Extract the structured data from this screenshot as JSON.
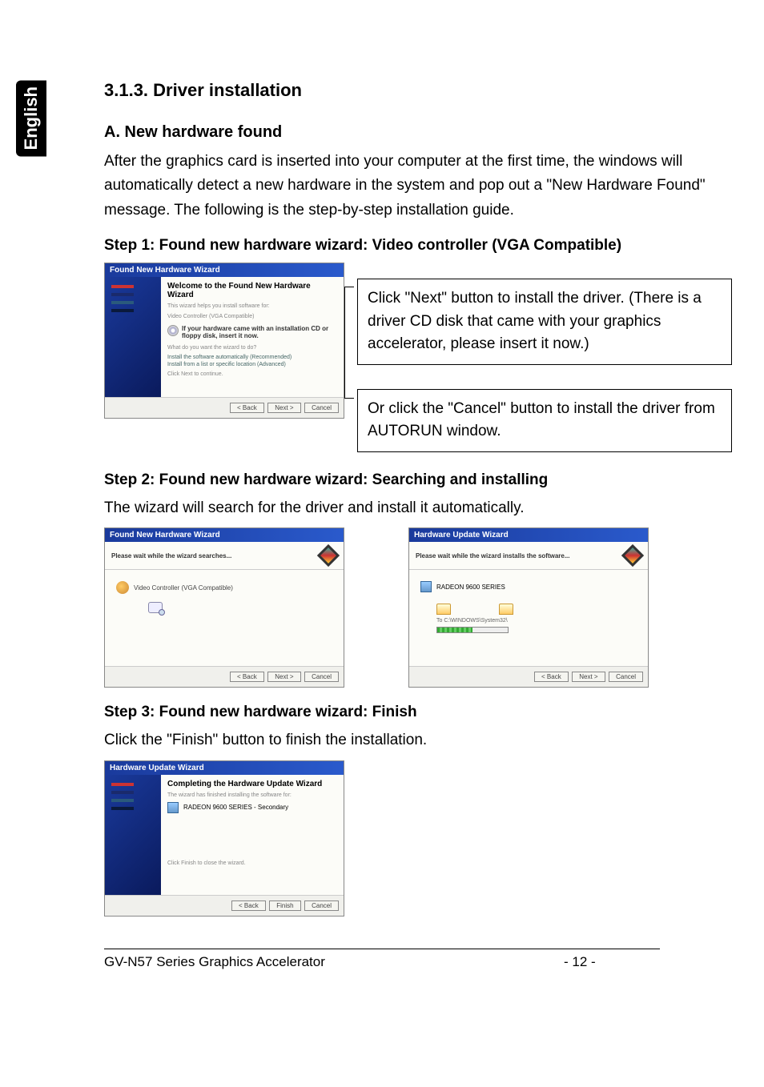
{
  "sideTab": "English",
  "section": {
    "number": "3.1.3. Driver installation",
    "subA": "A. New hardware found",
    "introText": "After the graphics card is inserted into your computer at the first time, the windows will automatically detect a new hardware in the system and pop out a \"New Hardware Found\" message. The following is the step-by-step installation guide."
  },
  "step1": {
    "title": "Step 1: Found new hardware wizard: Video controller (VGA Compatible)",
    "wizardTitle": "Found New Hardware Wizard",
    "welcome": "Welcome to the Found New Hardware Wizard",
    "wizText1": "This wizard helps you install software for:",
    "wizText2": "Video Controller (VGA Compatible)",
    "cdText": "If your hardware came with an installation CD or floppy disk, insert it now.",
    "question": "What do you want the wizard to do?",
    "radio1": "Install the software automatically (Recommended)",
    "radio2": "Install from a list or specific location (Advanced)",
    "continue": "Click Next to continue.",
    "btnBack": "< Back",
    "btnNext": "Next >",
    "btnCancel": "Cancel",
    "callout1": "Click \"Next\" button to install the driver. (There is a driver CD disk that came with your graphics accelerator, please insert it now.)",
    "callout2": "Or click the \"Cancel\" button to install the driver from AUTORUN window."
  },
  "step2": {
    "title": "Step 2: Found new hardware wizard: Searching and installing",
    "desc": "The wizard will search for the driver and install it automatically.",
    "wiz1Title": "Found New Hardware Wizard",
    "wiz1Header": "Please wait while the wizard searches...",
    "wiz1Item": "Video Controller (VGA Compatible)",
    "wiz2Title": "Hardware Update Wizard",
    "wiz2Header": "Please wait while the wizard installs the software...",
    "wiz2Item": "RADEON 9600 SERIES",
    "wiz2Path": "To C:\\WINDOWS\\System32\\",
    "btnBack": "< Back",
    "btnNext": "Next >",
    "btnCancel": "Cancel"
  },
  "step3": {
    "title": "Step 3: Found new hardware wizard: Finish",
    "desc": "Click the \"Finish\" button to finish the installation.",
    "wizTitle": "Hardware Update Wizard",
    "completing": "Completing the Hardware Update Wizard",
    "finishedText": "The wizard has finished installing the software for:",
    "device": "RADEON 9600 SERIES - Secondary",
    "closeText": "Click Finish to close the wizard.",
    "btnBack": "< Back",
    "btnFinish": "Finish",
    "btnCancel": "Cancel"
  },
  "footer": {
    "product": "GV-N57 Series Graphics Accelerator",
    "page": "- 12 -"
  }
}
